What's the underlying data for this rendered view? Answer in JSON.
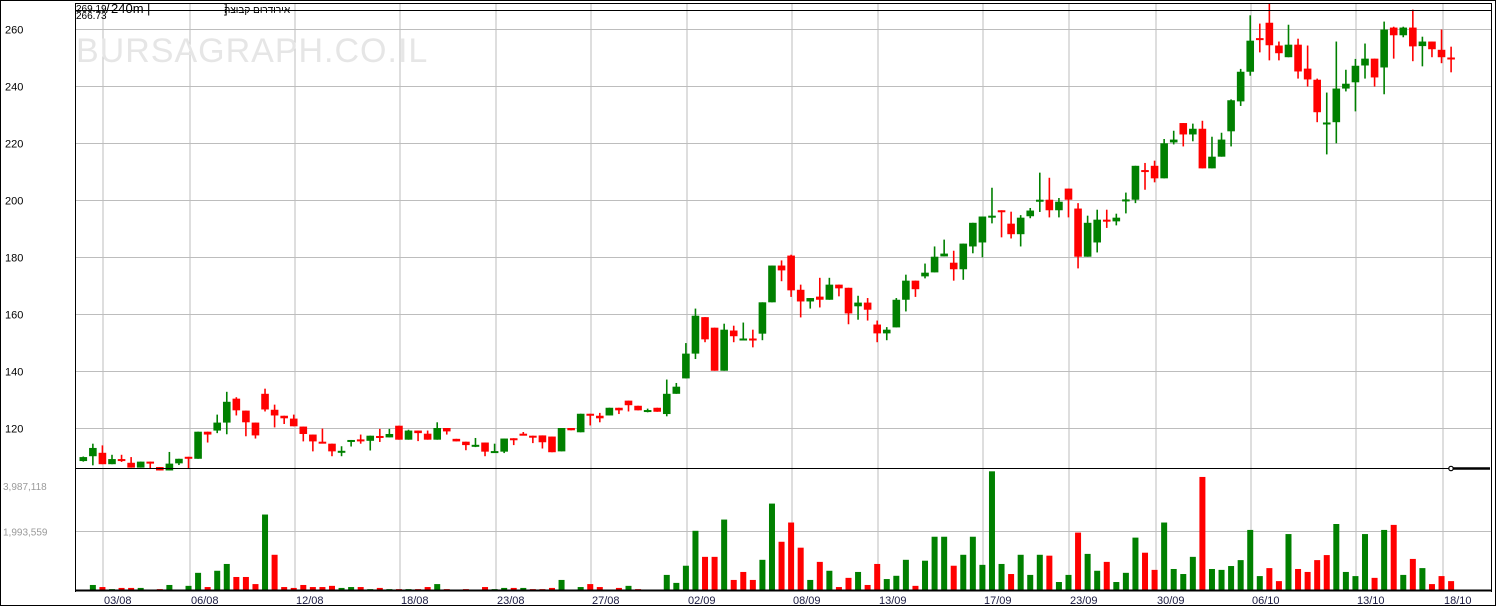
{
  "header": {
    "range_high": "269.19",
    "last_line_value": "266.73",
    "interval": "240m",
    "title": "אירודרום קבוצה",
    "separator": "|",
    "bracket": "]",
    "slash": "/"
  },
  "watermark": "BURSAGRAPH.CO.IL",
  "colors": {
    "up": "#008000",
    "down": "#ff0000",
    "grid": "#bdbdbd",
    "axis": "#000000"
  },
  "chart_data": {
    "type": "candlestick",
    "title": "אירודרום קבוצה 240m",
    "price_axis": {
      "ticks": [
        "120",
        "140",
        "160",
        "180",
        "200",
        "220",
        "240",
        "260"
      ],
      "tick_values": [
        120,
        140,
        160,
        180,
        200,
        220,
        240,
        260
      ],
      "ylim_reference": {
        "top_grid": 260,
        "bottom_grid": 120
      }
    },
    "volume_axis": {
      "ticks": [
        "1,993,559",
        "3,987,118"
      ],
      "tick_values": [
        1993559,
        3987118
      ]
    },
    "x_labels": [
      {
        "label": "03/08",
        "candle": 3
      },
      {
        "label": "06/08",
        "candle": 12
      },
      {
        "label": "12/08",
        "candle": 23
      },
      {
        "label": "18/08",
        "candle": 34
      },
      {
        "label": "23/08",
        "candle": 44
      },
      {
        "label": "27/08",
        "candle": 54
      },
      {
        "label": "02/09",
        "candle": 64
      },
      {
        "label": "08/09",
        "candle": 75
      },
      {
        "label": "13/09",
        "candle": 84
      },
      {
        "label": "17/09",
        "candle": 95
      },
      {
        "label": "23/09",
        "candle": 104
      },
      {
        "label": "30/09",
        "candle": 113
      },
      {
        "label": "06/10",
        "candle": 123
      },
      {
        "label": "13/10",
        "candle": 134
      },
      {
        "label": "18/10",
        "candle": 143
      }
    ],
    "ohlc_columns": [
      "open",
      "high",
      "low",
      "close"
    ],
    "ohlc": [
      [
        108.4,
        110,
        108.2,
        109.8
      ],
      [
        110.1,
        114.5,
        106.9,
        113.0
      ],
      [
        111.3,
        113.9,
        107.3,
        107.3
      ],
      [
        107.3,
        110.6,
        107.3,
        109.1
      ],
      [
        109.1,
        110.6,
        108.1,
        108.7
      ],
      [
        107.8,
        109.8,
        106.1,
        106.1
      ],
      [
        106.1,
        108.2,
        106.1,
        108.2
      ],
      [
        108.2,
        108.2,
        105.6,
        107.6
      ],
      [
        106.3,
        106.3,
        105.1,
        105.1
      ],
      [
        105.1,
        111.6,
        105.1,
        107.5
      ],
      [
        107.6,
        109.2,
        107.0,
        109.2
      ],
      [
        109.9,
        109.9,
        105.6,
        109.2
      ],
      [
        109.2,
        118.7,
        109.2,
        118.7
      ],
      [
        118.7,
        118.7,
        114.9,
        117.7
      ],
      [
        119.1,
        124.7,
        118.2,
        121.9
      ],
      [
        121.9,
        132.7,
        117.8,
        129.2
      ],
      [
        130.3,
        130.8,
        124.4,
        126.2
      ],
      [
        126.1,
        126.1,
        117.1,
        122.0
      ],
      [
        121.9,
        121.9,
        116.3,
        117.4
      ],
      [
        132.0,
        133.8,
        125.8,
        126.5
      ],
      [
        126.4,
        128.2,
        120.2,
        124.4
      ],
      [
        124.3,
        124.3,
        121.4,
        123.4
      ],
      [
        123.3,
        124.7,
        120.6,
        120.6
      ],
      [
        120.5,
        120.5,
        115.3,
        117.9
      ],
      [
        117.7,
        117.7,
        111.8,
        115.3
      ],
      [
        115.2,
        119.8,
        114.7,
        114.7
      ],
      [
        114.5,
        114.5,
        110.1,
        111.8
      ],
      [
        111.7,
        113.6,
        110.1,
        112.0
      ],
      [
        115.6,
        115.8,
        113.5,
        115.8
      ],
      [
        116.0,
        117.7,
        114.5,
        115.7
      ],
      [
        115.5,
        117.3,
        112.1,
        117.3
      ],
      [
        117.2,
        119.7,
        115.1,
        116.8
      ],
      [
        116.7,
        119.7,
        116.7,
        117.9
      ],
      [
        120.8,
        120.8,
        115.9,
        115.9
      ],
      [
        115.9,
        119.4,
        115.9,
        119.1
      ],
      [
        119.1,
        119.1,
        115.4,
        118.2
      ],
      [
        118.0,
        119.1,
        115.9,
        115.9
      ],
      [
        115.9,
        122.0,
        115.9,
        120.0
      ],
      [
        120.0,
        120.0,
        117.7,
        118.8
      ],
      [
        116.2,
        116.2,
        115.3,
        115.3
      ],
      [
        115.2,
        115.2,
        112.2,
        114.0
      ],
      [
        113.9,
        116.5,
        113.3,
        114.1
      ],
      [
        114.9,
        114.9,
        110.1,
        111.7
      ],
      [
        111.7,
        114.5,
        111.7,
        111.9
      ],
      [
        111.7,
        116.3,
        111.2,
        116.3
      ],
      [
        116.4,
        116.4,
        114.0,
        116.1
      ],
      [
        118.0,
        118.6,
        117.4,
        117.4
      ],
      [
        117.3,
        117.3,
        114.7,
        117.1
      ],
      [
        117.4,
        117.4,
        112.8,
        115.0
      ],
      [
        117.0,
        117.0,
        111.5,
        111.5
      ],
      [
        111.8,
        120.0,
        111.8,
        120.0
      ],
      [
        120.0,
        120.0,
        119.2,
        119.2
      ],
      [
        118.5,
        125.0,
        118.5,
        125.0
      ],
      [
        125.0,
        125.0,
        120.9,
        124.6
      ],
      [
        124.3,
        125.3,
        122.0,
        123.4
      ],
      [
        124.4,
        127.1,
        124.4,
        127.1
      ],
      [
        127.1,
        127.1,
        124.9,
        126.2
      ],
      [
        129.6,
        129.6,
        125.8,
        128.0
      ],
      [
        127.8,
        127.8,
        126.2,
        126.2
      ],
      [
        126.1,
        126.8,
        125.5,
        126.3
      ],
      [
        127.1,
        127.1,
        125.7,
        125.7
      ],
      [
        124.9,
        137.0,
        124.1,
        132.0
      ],
      [
        132.0,
        135.8,
        132.0,
        134.5
      ],
      [
        137.4,
        149.8,
        137.4,
        146.1
      ],
      [
        146.1,
        161.9,
        144.2,
        159.4
      ],
      [
        158.9,
        158.9,
        150.1,
        151.1
      ],
      [
        155.2,
        155.2,
        140.1,
        140.1
      ],
      [
        140.1,
        156.6,
        140.1,
        154.5
      ],
      [
        154.2,
        155.9,
        150.1,
        152.2
      ],
      [
        151.0,
        157.0,
        151.0,
        151.4
      ],
      [
        151.4,
        154.5,
        148.3,
        151.0
      ],
      [
        153.1,
        164.1,
        150.8,
        164.1
      ],
      [
        164.1,
        177.0,
        164.1,
        177.0
      ],
      [
        177.0,
        178.8,
        171.5,
        175.3
      ],
      [
        180.5,
        180.8,
        166.0,
        168.3
      ],
      [
        168.5,
        170.3,
        158.8,
        164.4
      ],
      [
        164.4,
        165.6,
        161.9,
        165.6
      ],
      [
        166.1,
        172.7,
        162.3,
        165.0
      ],
      [
        165.0,
        172.7,
        165.0,
        170.3
      ],
      [
        170.3,
        170.3,
        166.2,
        169.0
      ],
      [
        169.2,
        169.2,
        156.4,
        160.2
      ],
      [
        162.7,
        166.4,
        158.0,
        164.0
      ],
      [
        164.0,
        165.6,
        157.7,
        161.5
      ],
      [
        156.3,
        157.7,
        150.1,
        153.2
      ],
      [
        153.2,
        155.4,
        150.8,
        154.5
      ],
      [
        155.3,
        165.6,
        155.3,
        165.0
      ],
      [
        165.0,
        173.8,
        160.9,
        171.7
      ],
      [
        171.7,
        171.7,
        166.0,
        168.7
      ],
      [
        173.2,
        177.7,
        172.5,
        174.5
      ],
      [
        174.6,
        183.7,
        174.6,
        180.1
      ],
      [
        180.2,
        186.1,
        180.2,
        181.2
      ],
      [
        178.0,
        182.2,
        171.7,
        175.7
      ],
      [
        175.7,
        184.7,
        172.0,
        184.7
      ],
      [
        183.7,
        192.0,
        181.3,
        192.0
      ],
      [
        185.1,
        194.2,
        179.9,
        194.2
      ],
      [
        194.3,
        204.3,
        191.8,
        194.5
      ],
      [
        196.4,
        196.4,
        186.9,
        195.8
      ],
      [
        191.7,
        195.9,
        186.5,
        188.0
      ],
      [
        188.0,
        194.7,
        183.7,
        193.8
      ],
      [
        194.3,
        197.2,
        193.6,
        196.3
      ],
      [
        200.0,
        209.6,
        195.8,
        200.1
      ],
      [
        200.1,
        207.8,
        193.9,
        196.4
      ],
      [
        196.4,
        200.7,
        193.9,
        199.4
      ],
      [
        204.0,
        204.0,
        193.9,
        200.1
      ],
      [
        197.0,
        198.9,
        176.0,
        180.1
      ],
      [
        180.1,
        194.5,
        180.1,
        192.0
      ],
      [
        185.1,
        196.6,
        181.6,
        193.1
      ],
      [
        193.1,
        196.6,
        190.2,
        192.6
      ],
      [
        192.5,
        195.2,
        191.1,
        193.8
      ],
      [
        200.0,
        202.6,
        195.3,
        200.2
      ],
      [
        200.1,
        212.0,
        198.9,
        212.0
      ],
      [
        210.5,
        213.0,
        203.6,
        210.1
      ],
      [
        212.0,
        213.8,
        206.2,
        207.6
      ],
      [
        207.6,
        221.4,
        207.6,
        219.9
      ],
      [
        220.2,
        224.3,
        219.5,
        221.2
      ],
      [
        227.0,
        227.0,
        218.8,
        223.0
      ],
      [
        223.0,
        226.8,
        220.6,
        225.0
      ],
      [
        225.0,
        227.8,
        211.1,
        211.1
      ],
      [
        211.1,
        222.2,
        211.1,
        215.2
      ],
      [
        215.2,
        223.6,
        215.2,
        221.2
      ],
      [
        224.1,
        235.3,
        218.8,
        235.0
      ],
      [
        234.6,
        246.0,
        233.0,
        245.0
      ],
      [
        245.0,
        264.8,
        243.6,
        255.9
      ],
      [
        256.8,
        261.9,
        251.8,
        256.6
      ],
      [
        262.2,
        269.1,
        249.0,
        254.3
      ],
      [
        254.2,
        255.6,
        249.0,
        251.5
      ],
      [
        250.1,
        261.5,
        250.1,
        254.5
      ],
      [
        254.5,
        256.6,
        242.6,
        245.1
      ],
      [
        246.1,
        254.2,
        239.8,
        242.3
      ],
      [
        242.2,
        242.6,
        227.3,
        230.8
      ],
      [
        227.1,
        237.7,
        216.0,
        227.2
      ],
      [
        227.3,
        255.6,
        219.9,
        239.1
      ],
      [
        239.1,
        245.7,
        238.1,
        240.8
      ],
      [
        241.3,
        249.5,
        231.1,
        247.1
      ],
      [
        247.2,
        254.9,
        242.6,
        249.6
      ],
      [
        249.6,
        249.6,
        239.8,
        243.0
      ],
      [
        246.5,
        262.6,
        237.1,
        259.8
      ],
      [
        260.5,
        260.8,
        249.6,
        257.8
      ],
      [
        257.8,
        260.8,
        257.1,
        260.5
      ],
      [
        260.5,
        266.8,
        248.7,
        253.9
      ],
      [
        254.0,
        257.3,
        246.9,
        255.6
      ],
      [
        255.6,
        255.6,
        250.1,
        252.9
      ],
      [
        252.7,
        259.8,
        248.0,
        250.1
      ],
      [
        250.0,
        253.8,
        244.8,
        249.8
      ]
    ],
    "volume_columns": [
      "volume_millions",
      "up(1)/down(0)"
    ],
    "volume": [
      [
        0.0,
        1
      ],
      [
        0.17,
        1
      ],
      [
        0.1,
        0
      ],
      [
        0.03,
        1
      ],
      [
        0.07,
        0
      ],
      [
        0.07,
        0
      ],
      [
        0.07,
        1
      ],
      [
        0.01,
        0
      ],
      [
        0.03,
        0
      ],
      [
        0.17,
        1
      ],
      [
        0.01,
        1
      ],
      [
        0.14,
        1
      ],
      [
        0.58,
        1
      ],
      [
        0.1,
        0
      ],
      [
        0.65,
        1
      ],
      [
        0.88,
        1
      ],
      [
        0.44,
        0
      ],
      [
        0.44,
        0
      ],
      [
        0.2,
        0
      ],
      [
        2.55,
        1
      ],
      [
        1.19,
        0
      ],
      [
        0.1,
        0
      ],
      [
        0.07,
        0
      ],
      [
        0.17,
        0
      ],
      [
        0.1,
        0
      ],
      [
        0.1,
        0
      ],
      [
        0.14,
        0
      ],
      [
        0.07,
        1
      ],
      [
        0.1,
        1
      ],
      [
        0.1,
        0
      ],
      [
        0.03,
        1
      ],
      [
        0.07,
        0
      ],
      [
        0.03,
        1
      ],
      [
        0.03,
        0
      ],
      [
        0.03,
        1
      ],
      [
        0.03,
        0
      ],
      [
        0.1,
        0
      ],
      [
        0.2,
        1
      ],
      [
        0.03,
        0
      ],
      [
        0.01,
        1
      ],
      [
        0.03,
        0
      ],
      [
        0.01,
        1
      ],
      [
        0.1,
        0
      ],
      [
        0.03,
        1
      ],
      [
        0.07,
        1
      ],
      [
        0.07,
        0
      ],
      [
        0.07,
        1
      ],
      [
        0.03,
        0
      ],
      [
        0.03,
        0
      ],
      [
        0.07,
        0
      ],
      [
        0.34,
        1
      ],
      [
        0.01,
        1
      ],
      [
        0.1,
        1
      ],
      [
        0.2,
        0
      ],
      [
        0.1,
        0
      ],
      [
        0.01,
        1
      ],
      [
        0.07,
        0
      ],
      [
        0.14,
        1
      ],
      [
        0.03,
        0
      ],
      [
        0.01,
        1
      ],
      [
        0.01,
        1
      ],
      [
        0.51,
        1
      ],
      [
        0.24,
        1
      ],
      [
        0.82,
        1
      ],
      [
        2.0,
        1
      ],
      [
        1.12,
        0
      ],
      [
        1.12,
        0
      ],
      [
        2.38,
        1
      ],
      [
        0.34,
        0
      ],
      [
        0.61,
        0
      ],
      [
        0.34,
        0
      ],
      [
        1.02,
        1
      ],
      [
        2.92,
        1
      ],
      [
        1.63,
        0
      ],
      [
        2.28,
        0
      ],
      [
        1.43,
        0
      ],
      [
        0.34,
        1
      ],
      [
        0.95,
        0
      ],
      [
        0.65,
        1
      ],
      [
        0.1,
        0
      ],
      [
        0.41,
        0
      ],
      [
        0.61,
        1
      ],
      [
        0.17,
        0
      ],
      [
        0.88,
        0
      ],
      [
        0.37,
        1
      ],
      [
        0.48,
        1
      ],
      [
        1.02,
        1
      ],
      [
        0.14,
        0
      ],
      [
        0.99,
        1
      ],
      [
        1.8,
        1
      ],
      [
        1.8,
        1
      ],
      [
        0.82,
        0
      ],
      [
        1.19,
        1
      ],
      [
        1.8,
        1
      ],
      [
        0.85,
        1
      ],
      [
        4.01,
        1
      ],
      [
        0.88,
        1
      ],
      [
        0.54,
        0
      ],
      [
        1.19,
        1
      ],
      [
        0.51,
        1
      ],
      [
        1.19,
        1
      ],
      [
        1.16,
        0
      ],
      [
        0.27,
        1
      ],
      [
        0.51,
        1
      ],
      [
        1.94,
        0
      ],
      [
        1.22,
        1
      ],
      [
        0.65,
        1
      ],
      [
        0.95,
        0
      ],
      [
        0.27,
        1
      ],
      [
        0.58,
        1
      ],
      [
        1.77,
        1
      ],
      [
        1.26,
        0
      ],
      [
        0.68,
        0
      ],
      [
        2.28,
        1
      ],
      [
        0.71,
        1
      ],
      [
        0.54,
        1
      ],
      [
        1.12,
        1
      ],
      [
        3.82,
        0
      ],
      [
        0.71,
        1
      ],
      [
        0.68,
        1
      ],
      [
        0.81,
        1
      ],
      [
        1.01,
        1
      ],
      [
        2.03,
        1
      ],
      [
        0.47,
        1
      ],
      [
        0.74,
        0
      ],
      [
        0.3,
        0
      ],
      [
        1.89,
        1
      ],
      [
        0.71,
        0
      ],
      [
        0.61,
        0
      ],
      [
        1.01,
        0
      ],
      [
        1.18,
        0
      ],
      [
        2.23,
        1
      ],
      [
        0.61,
        1
      ],
      [
        0.47,
        1
      ],
      [
        1.89,
        1
      ],
      [
        0.41,
        0
      ],
      [
        2.03,
        1
      ],
      [
        2.2,
        0
      ],
      [
        0.51,
        1
      ],
      [
        1.05,
        0
      ],
      [
        0.74,
        1
      ],
      [
        0.2,
        0
      ],
      [
        0.47,
        0
      ],
      [
        0.3,
        0
      ]
    ]
  }
}
